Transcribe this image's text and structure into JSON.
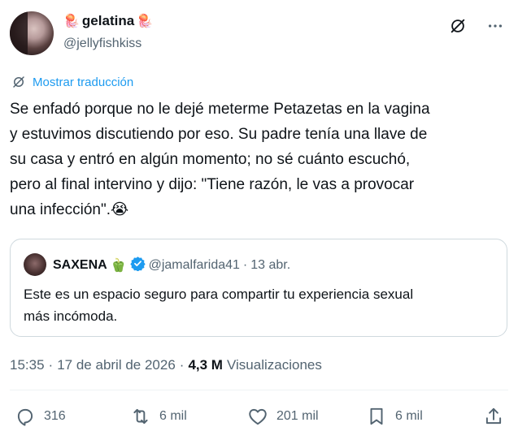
{
  "tweet": {
    "display_name": "gelatina",
    "name_emoji": "🪼",
    "handle": "@jellyfishkiss",
    "translate_label": "Mostrar traducción",
    "text_lines": [
      "Se enfadó porque no le dejé meterme Petazetas en la vagina",
      "y estuvimos discutiendo por eso. Su padre tenía una llave de",
      "su casa y entró en algún momento; no sé cuánto escuchó,",
      "pero al final intervino y dijo: \"Tiene razón, le vas a provocar",
      "una infección\".😭"
    ],
    "time": "15:35",
    "date": "17 de abril de 2026",
    "separator": "·",
    "views_count": "4,3 M",
    "views_label": "Visualizaciones"
  },
  "quote": {
    "display_name": "SAXENA",
    "name_emoji": "🫑",
    "handle": "@jamalfarida41",
    "separator": "·",
    "date": "13 abr.",
    "text_lines": [
      "Este es un espacio seguro para compartir tu experiencia sexual",
      "más incómoda."
    ]
  },
  "actions": {
    "replies": "316",
    "reposts": "6 mil",
    "likes": "201 mil",
    "bookmarks": "6 mil"
  },
  "colors": {
    "accent": "#1d9bf0",
    "secondary_text": "#536471",
    "border": "#cfd9de",
    "verified": "#1d9bf0"
  },
  "icons": {
    "grok": "grok-icon",
    "more": "more-icon",
    "translate": "translate-icon",
    "verified": "verified-badge-icon",
    "reply": "reply-icon",
    "repost": "repost-icon",
    "like": "like-icon",
    "bookmark": "bookmark-icon",
    "share": "share-icon"
  }
}
